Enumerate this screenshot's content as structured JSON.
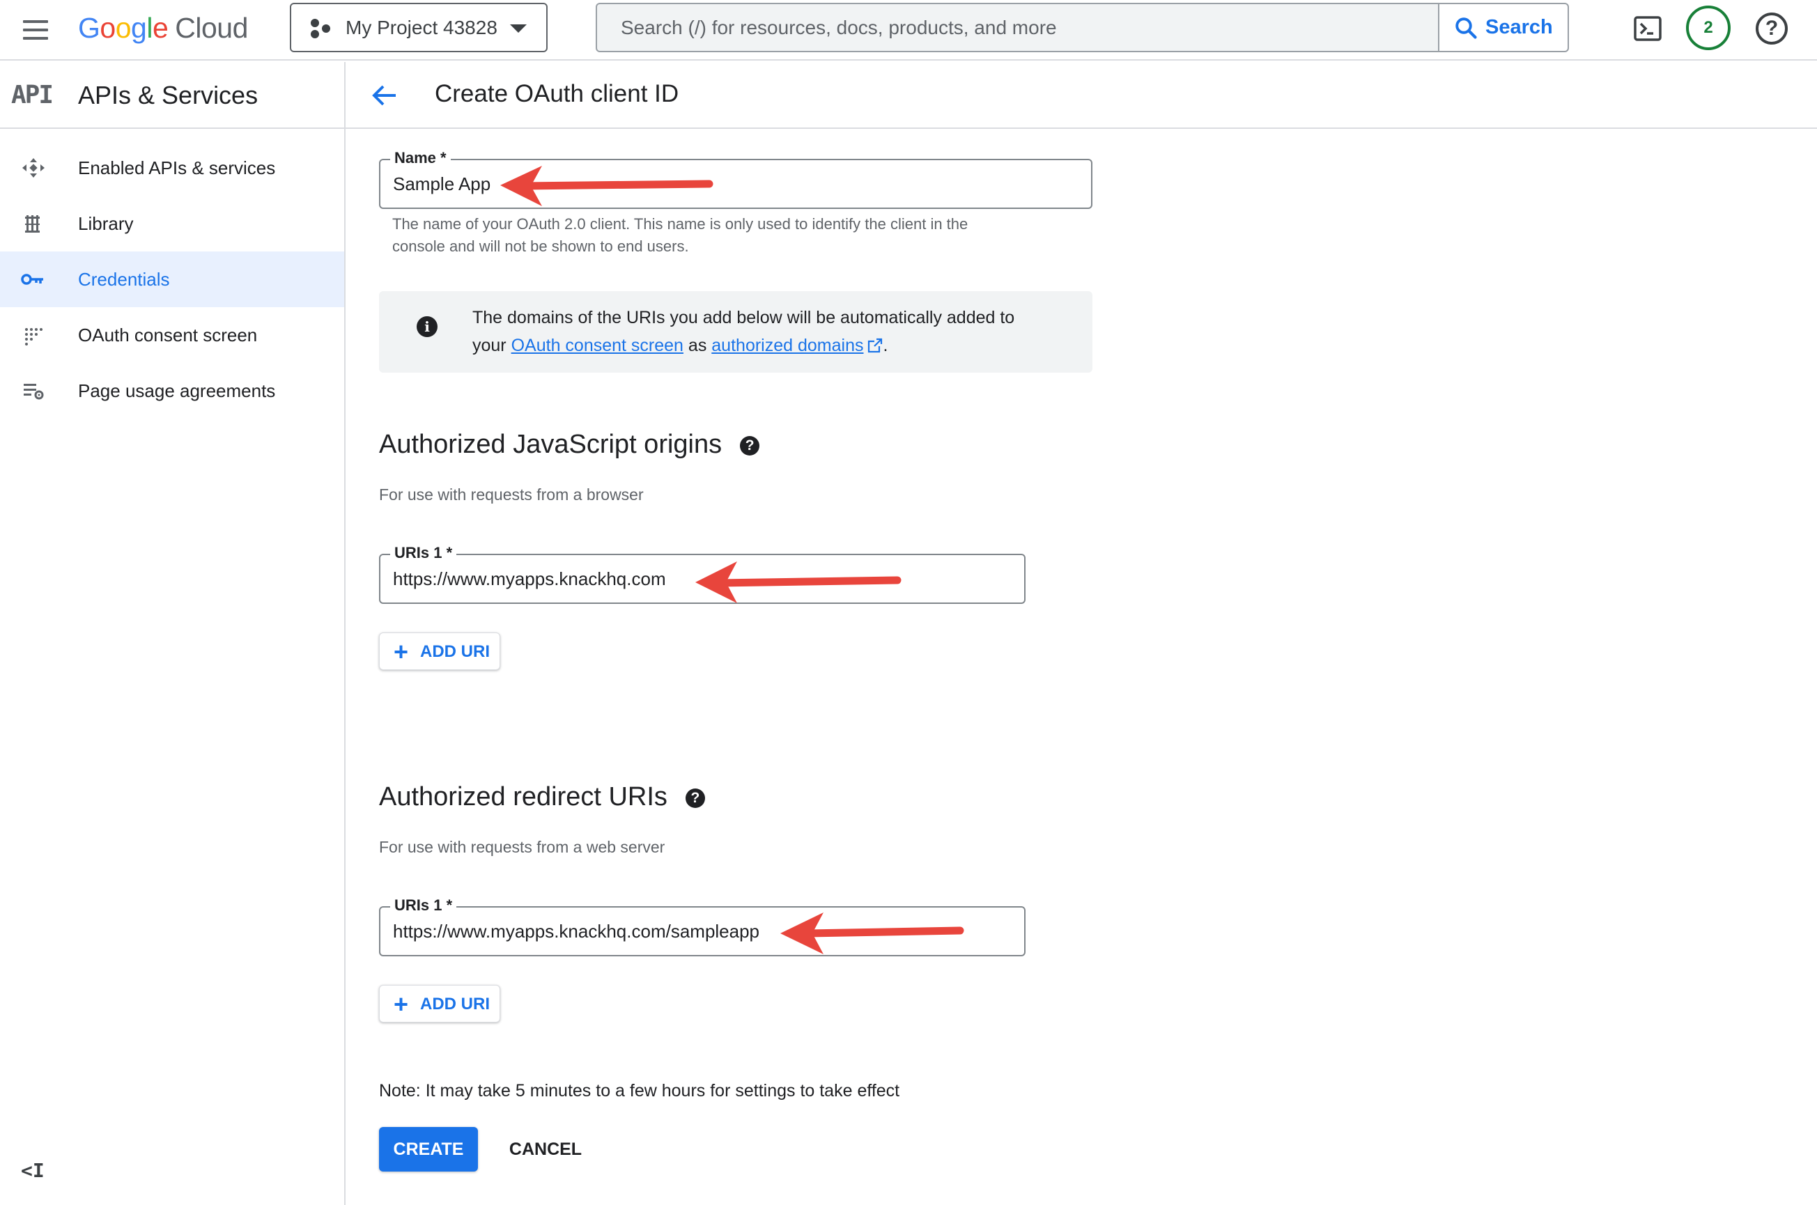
{
  "topbar": {
    "brand": {
      "g1": "G",
      "g2": "o",
      "g3": "o",
      "g4": "g",
      "g5": "l",
      "g6": "e",
      "product": "Cloud"
    },
    "project": "My Project 43828",
    "search_placeholder": "Search (/) for resources, docs, products, and more",
    "search_button": "Search",
    "notification_count": "2",
    "help": "?"
  },
  "sidebar": {
    "logo": "API",
    "title": "APIs & Services",
    "items": [
      {
        "label": "Enabled APIs & services",
        "icon": "enabled-apis-icon"
      },
      {
        "label": "Library",
        "icon": "library-icon"
      },
      {
        "label": "Credentials",
        "icon": "key-icon",
        "active": true
      },
      {
        "label": "OAuth consent screen",
        "icon": "consent-grid-icon"
      },
      {
        "label": "Page usage agreements",
        "icon": "settings-list-icon"
      }
    ],
    "collapse": "<I"
  },
  "main": {
    "title": "Create OAuth client ID",
    "name_field": {
      "label": "Name *",
      "value": "Sample App",
      "helper_line1": "The name of your OAuth 2.0 client. This name is only used to identify the client in the",
      "helper_line2": "console and will not be shown to end users."
    },
    "info": {
      "icon": "i",
      "line1": "The domains of the URIs you add below will be automatically added to",
      "line2_prefix": "your",
      "link1": "OAuth consent screen",
      "middle": "as",
      "link2": "authorized domains",
      "suffix": "."
    },
    "js_origins": {
      "title": "Authorized JavaScript origins",
      "subtitle": "For use with requests from a browser",
      "uri_label": "URIs 1 *",
      "uri_value": "https://www.myapps.knackhq.com",
      "add_button": "ADD URI"
    },
    "redirect_uris": {
      "title": "Authorized redirect URIs",
      "subtitle": "For use with requests from a web server",
      "uri_label": "URIs 1 *",
      "uri_value": "https://www.myapps.knackhq.com/sampleapp",
      "add_button": "ADD URI"
    },
    "note": "Note: It may take 5 minutes to a few hours for settings to take effect",
    "create_button": "CREATE",
    "cancel_button": "CANCEL"
  },
  "colors": {
    "accent": "#1a73e8",
    "annotation_arrow": "#e8453c",
    "active_nav_bg": "#e8f0fe",
    "badge": "#188038"
  }
}
